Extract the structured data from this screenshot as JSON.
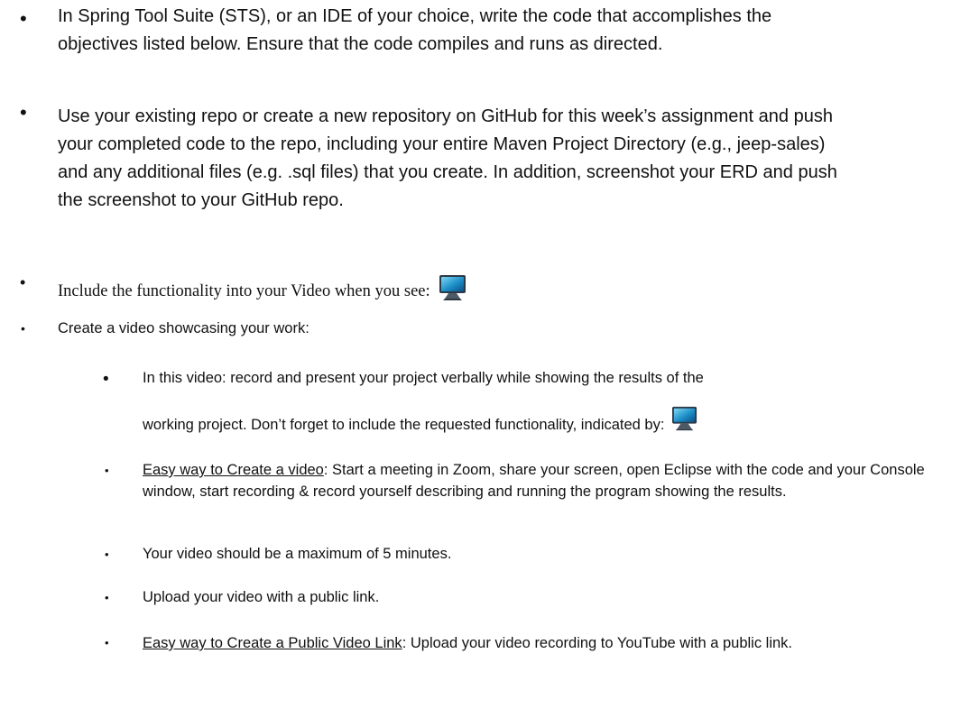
{
  "bullets": {
    "b1": {
      "symbol": "•",
      "text": "In Spring Tool Suite (STS), or an IDE of your choice, write the code that accomplishes the objectives listed below. Ensure that the code compiles and runs as directed."
    },
    "b2": {
      "symbol": "•",
      "text": "Use your existing repo or create a new repository on GitHub for this week’s assignment and push your completed code to the repo, including your entire Maven Project Directory (e.g., jeep-sales) and any additional files (e.g. .sql files) that you create.  In addition, screenshot your ERD and push the screenshot to your GitHub repo."
    },
    "b3": {
      "symbol": "•",
      "text": "Include the functionality into your Video when you see:",
      "icon": "video-monitor-icon"
    },
    "b4": {
      "symbol": "•",
      "text": "Create a video showcasing your work:"
    }
  },
  "sub": {
    "s1": {
      "symbol": "•",
      "line1": "In this video: record and present your project verbally while showing the results of the",
      "line2": "working project.   Don’t forget to include the requested functionality, indicated by:",
      "icon": "video-monitor-icon"
    },
    "s2": {
      "symbol": "•",
      "link": "Easy way to Create a video",
      "text": ":  Start a meeting in Zoom, share your screen, open Eclipse with the code and your Console window, start recording & record yourself describing and running the program showing the results."
    },
    "s3": {
      "symbol": "•",
      "text": "Your video should be a maximum of 5 minutes."
    },
    "s4": {
      "symbol": "•",
      "text": "Upload your video with a public link."
    },
    "s5": {
      "symbol": "•",
      "link": "Easy way to Create a Public Video Link",
      "text": ":  Upload your video recording to YouTube with a public link."
    }
  }
}
